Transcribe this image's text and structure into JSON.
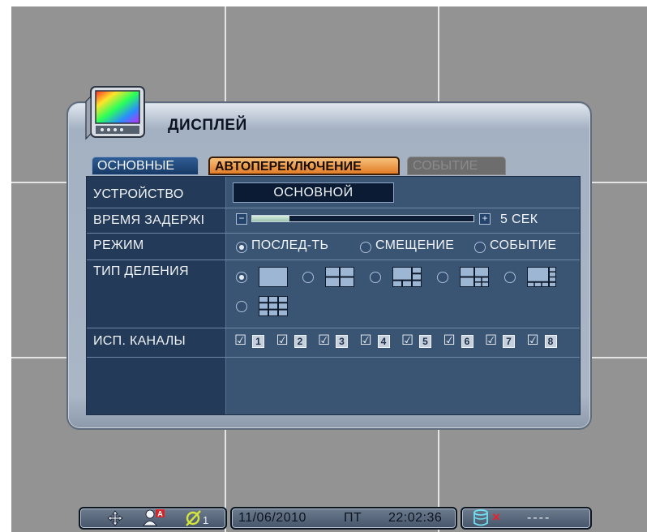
{
  "dialog": {
    "title": "ДИСПЛЕЙ",
    "icon": "monitor-color-icon"
  },
  "tabs": [
    {
      "label": "ОСНОВНЫЕ",
      "active": false
    },
    {
      "label": "АВТОПЕРЕКЛЮЧЕНИЕ",
      "active": true
    },
    {
      "label": "СОБЫТИЕ",
      "active": false,
      "disabled": true
    }
  ],
  "rows": {
    "device": {
      "label": "УСТРОЙСТВО",
      "value": "ОСНОВНОЙ"
    },
    "delay": {
      "label": "ВРЕМЯ ЗАДЕРЖІ",
      "minus": "−",
      "plus": "+",
      "value": "5 СЕК",
      "level": 0.17
    },
    "mode": {
      "label": "РЕЖИМ",
      "options": [
        "ПОСЛЕД-ТЬ",
        "СМЕЩЕНИЕ",
        "СОБЫТИЕ"
      ],
      "selected": 0
    },
    "split": {
      "label": "ТИП ДЕЛЕНИЯ",
      "options": [
        "split-1-icon",
        "split-4-icon",
        "split-6-icon",
        "split-7-icon",
        "split-8-icon",
        "split-9-icon"
      ],
      "selected": 0
    },
    "channels": {
      "label": "ИСП. КАНАЛЫ",
      "items": [
        "1",
        "2",
        "3",
        "4",
        "5",
        "6",
        "7",
        "8"
      ],
      "checked": [
        true,
        true,
        true,
        true,
        true,
        true,
        true,
        true
      ]
    }
  },
  "statusbar": {
    "icons": [
      "move-arrows-icon",
      "user-alarm-icon",
      "network-icon"
    ],
    "network_count": "1",
    "date": "11/06/2010",
    "weekday": "ПТ",
    "time": "22:02:36",
    "disk_icon": "disk-icon",
    "disk_status": "×",
    "disk_value": "----"
  },
  "colors": {
    "accent_tab": "#e27d28",
    "panel": "#3a5474",
    "label_col": "#233a59",
    "screen_bg": "#939393"
  }
}
